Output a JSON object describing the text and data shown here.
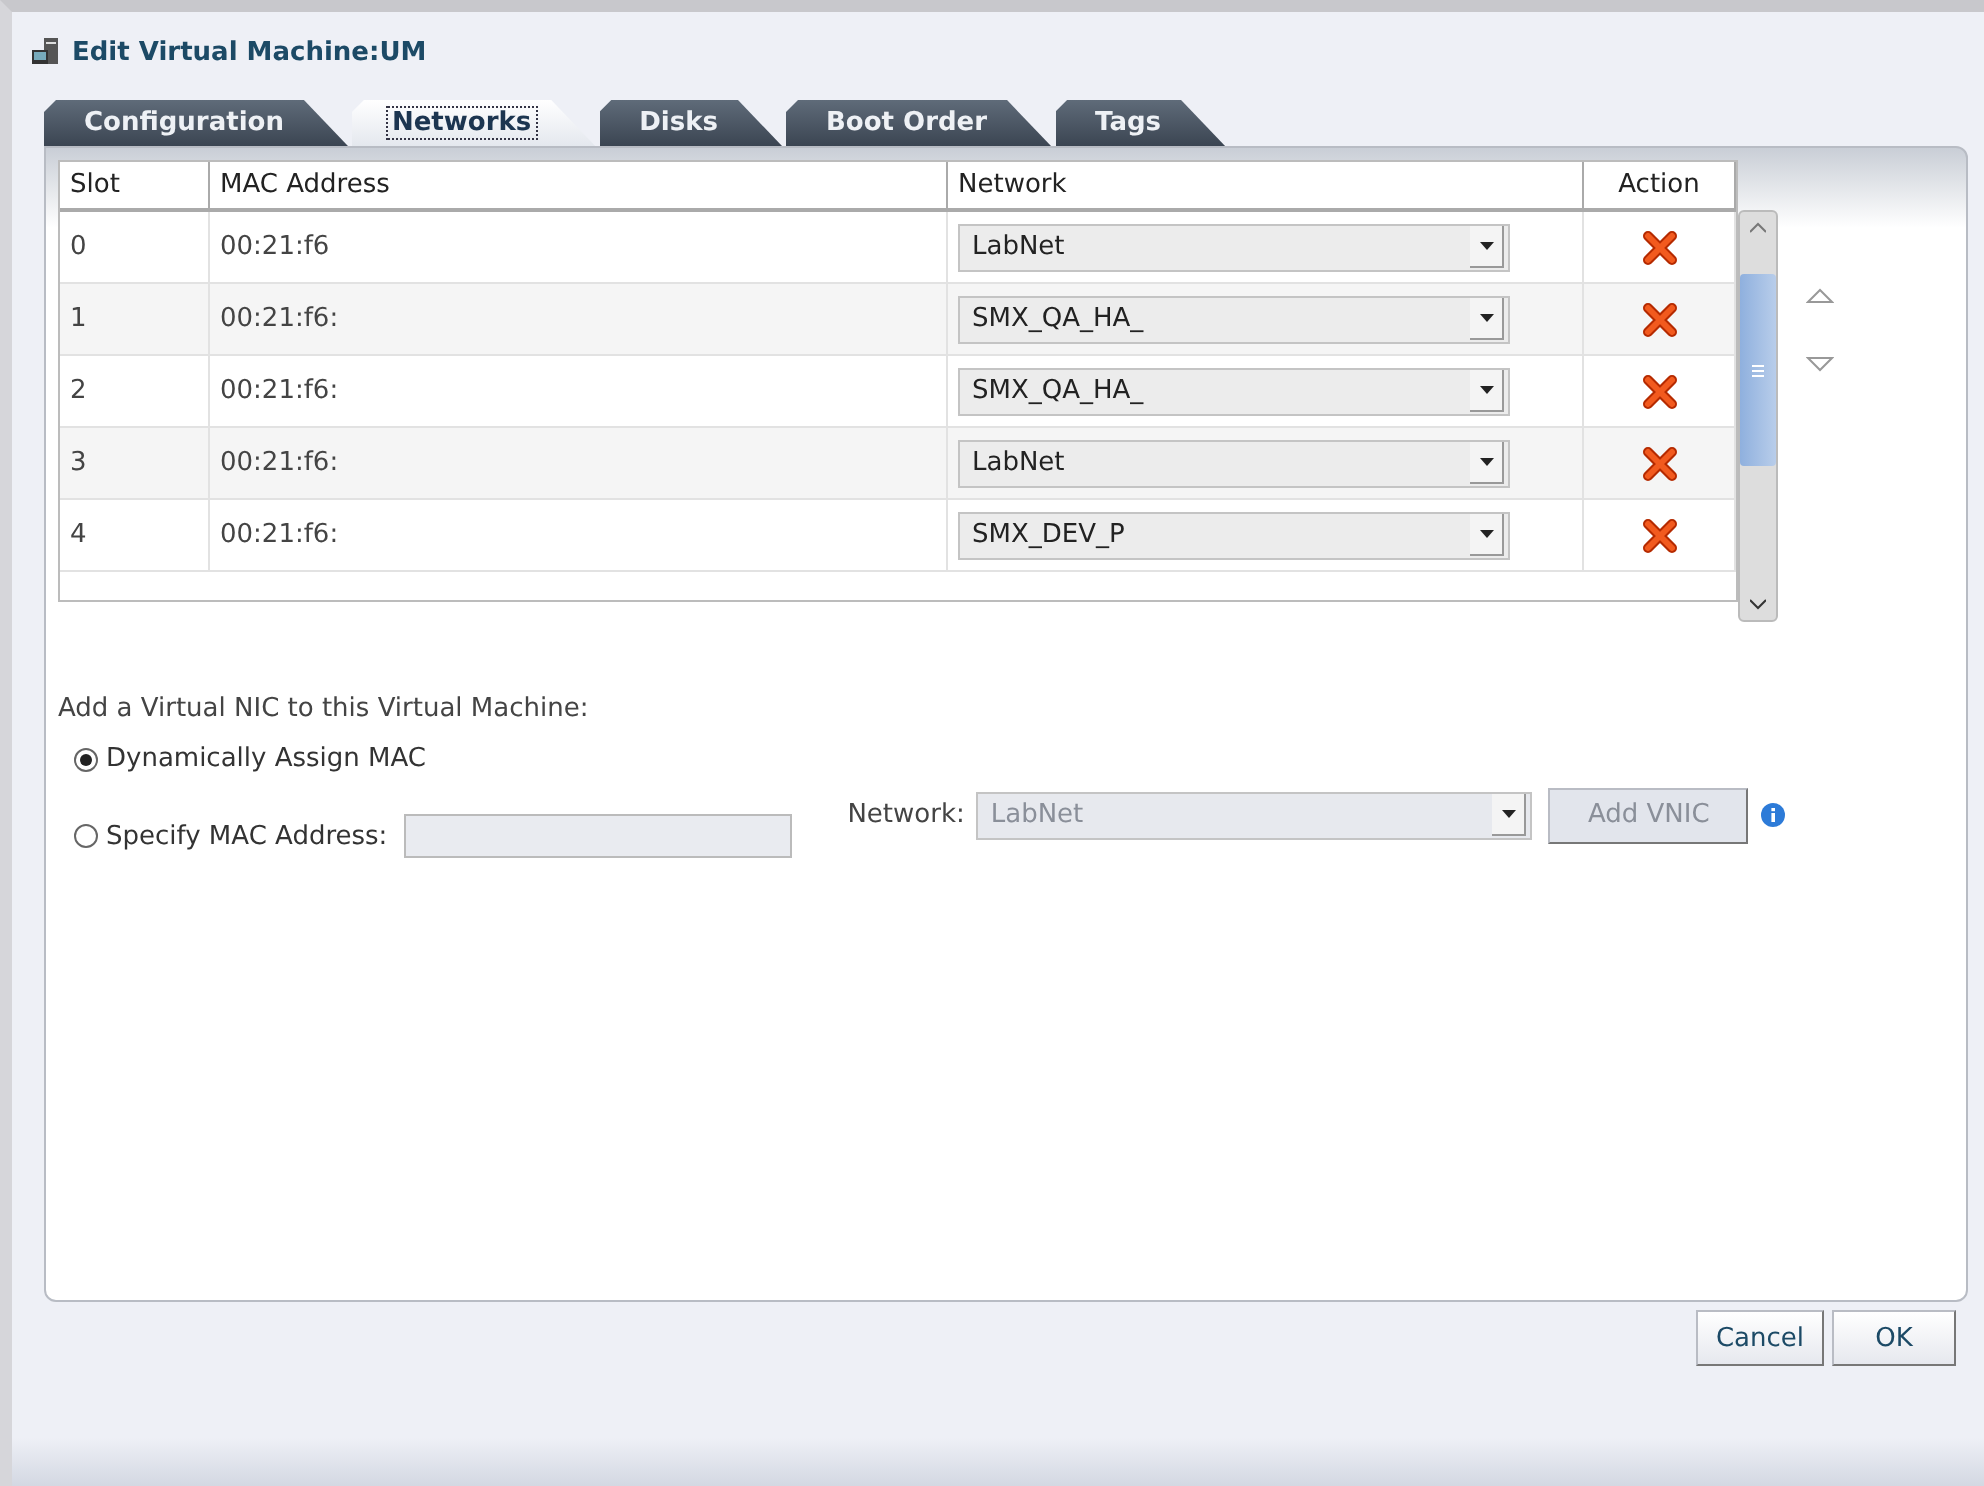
{
  "window": {
    "title": "Edit Virtual Machine:UM"
  },
  "tabs": [
    {
      "label": "Configuration",
      "selected": false
    },
    {
      "label": "Networks",
      "selected": true
    },
    {
      "label": "Disks",
      "selected": false
    },
    {
      "label": "Boot Order",
      "selected": false
    },
    {
      "label": "Tags",
      "selected": false
    }
  ],
  "table": {
    "columns": [
      "Slot",
      "MAC Address",
      "Network",
      "Action"
    ],
    "rows": [
      {
        "slot": "0",
        "mac": "00:21:f6",
        "network": "LabNet"
      },
      {
        "slot": "1",
        "mac": "00:21:f6:",
        "network": "SMX_QA_HA_"
      },
      {
        "slot": "2",
        "mac": "00:21:f6:",
        "network": "SMX_QA_HA_"
      },
      {
        "slot": "3",
        "mac": "00:21:f6:",
        "network": "LabNet"
      },
      {
        "slot": "4",
        "mac": "00:21:f6:",
        "network": "SMX_DEV_P"
      }
    ]
  },
  "add_nic": {
    "heading": "Add a Virtual NIC to this Virtual Machine:",
    "options": [
      {
        "label": "Dynamically Assign MAC",
        "selected": true
      },
      {
        "label": "Specify MAC Address:",
        "selected": false
      }
    ],
    "network_label": "Network:",
    "network_value": "LabNet",
    "add_button": "Add VNIC",
    "disabled": true
  },
  "buttons": [
    "Cancel",
    "OK"
  ]
}
